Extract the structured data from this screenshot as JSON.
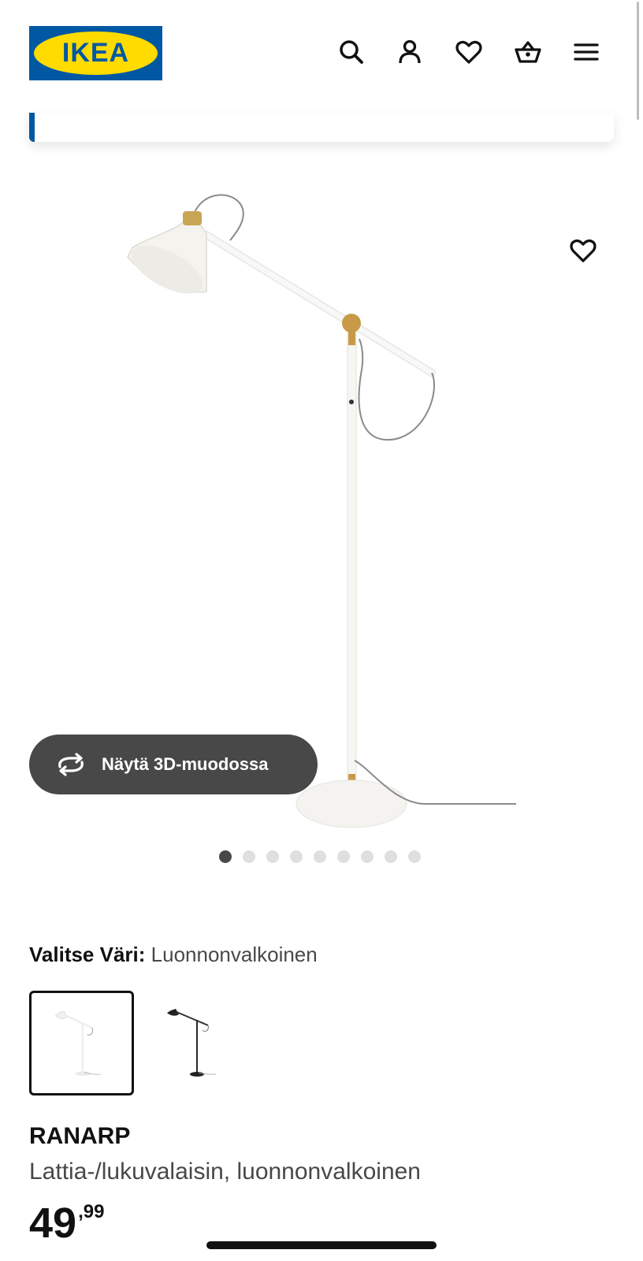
{
  "header": {
    "logo_text": "IKEA",
    "icons": [
      "search-icon",
      "account-icon",
      "heart-icon",
      "basket-icon",
      "menu-icon"
    ]
  },
  "product": {
    "color_prompt": "Valitse Väri:",
    "color_value": "Luonnonvalkoinen",
    "name": "RANARP",
    "description": "Lattia-/lukuvalaisin, luonnonvalkoinen",
    "price_integer": "49",
    "price_decimal": ",99"
  },
  "view3d": {
    "label": "Näytä 3D-muodossa"
  },
  "gallery": {
    "total_images": 9,
    "active_index": 0
  },
  "colors": {
    "ikea_blue": "#0058a3",
    "ikea_yellow": "#ffdb00",
    "button_dark": "#484848"
  }
}
